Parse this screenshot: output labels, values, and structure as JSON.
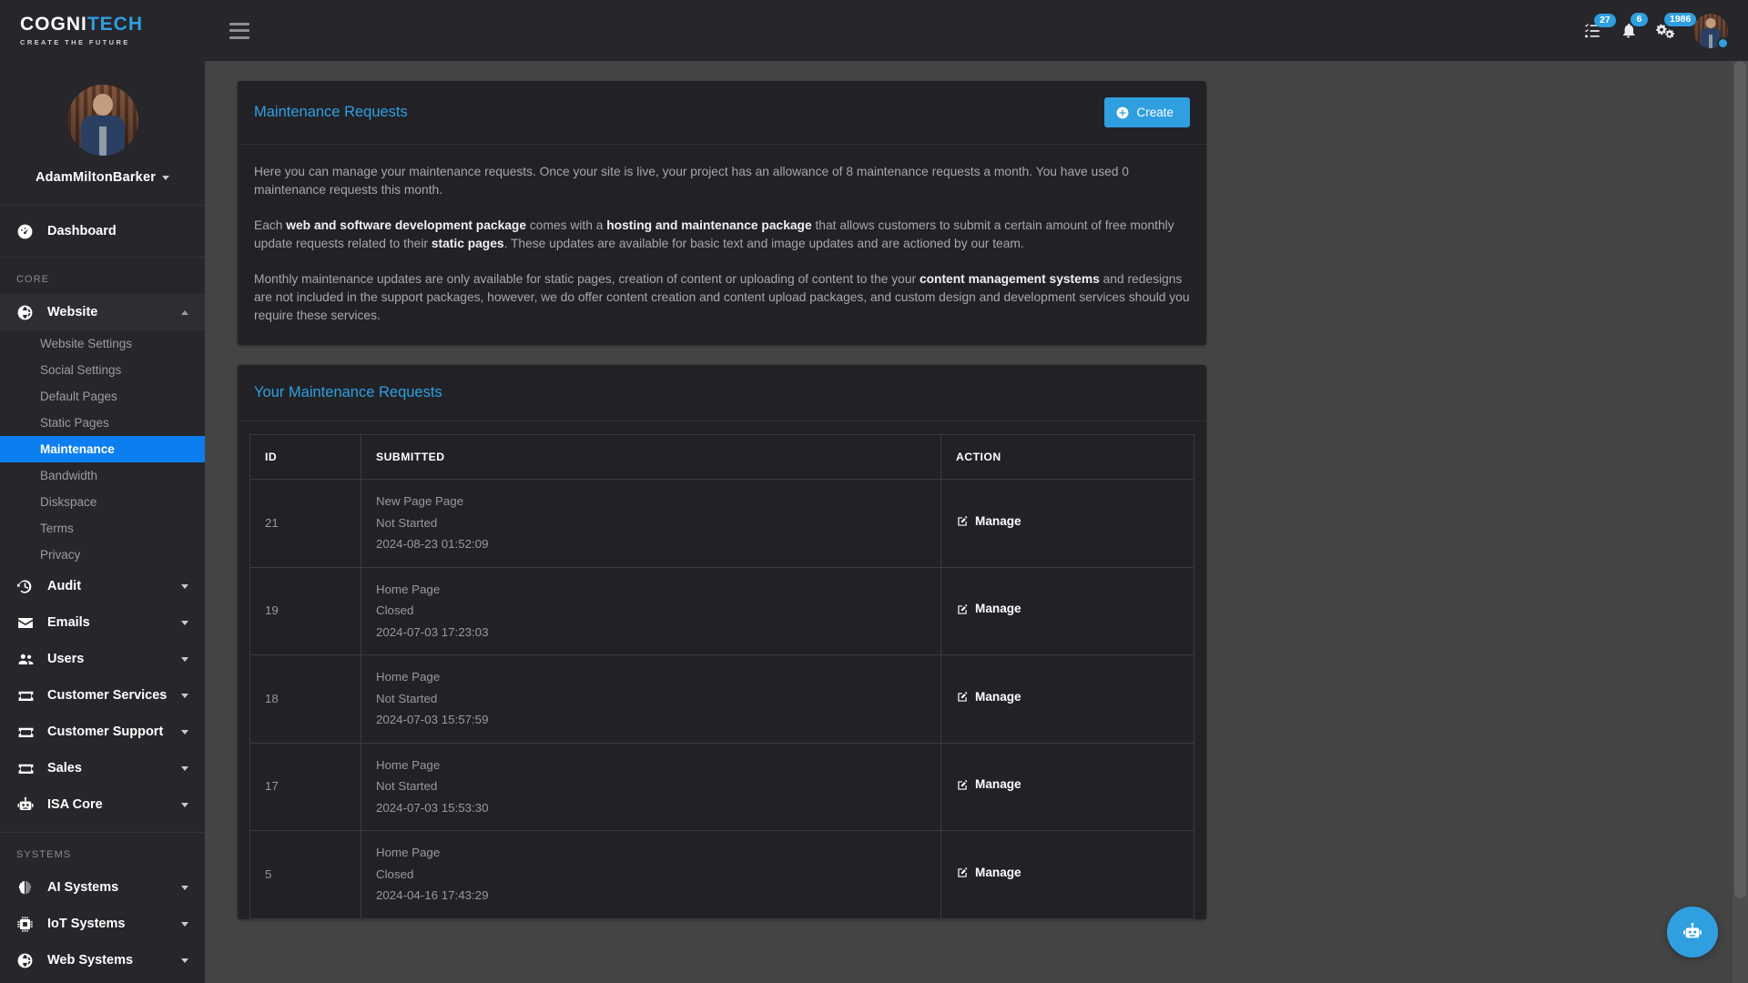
{
  "brand": {
    "name_light": "COGNI",
    "name_accent": "TECH",
    "tagline": "CREATE THE FUTURE",
    "accent_color": "#2f9fe0"
  },
  "topbar": {
    "menu_toggle": "hamburger-menu",
    "tasks": {
      "icon": "tasks-icon",
      "badge": "27"
    },
    "notifications": {
      "icon": "bell-icon",
      "badge": "6"
    },
    "settings": {
      "icon": "gears-icon",
      "badge": "1986"
    },
    "avatar": {
      "icon": "user-avatar",
      "status": "online"
    }
  },
  "sidebar": {
    "profile": {
      "name": "AdamMiltonBarker",
      "caret": "chevron-down-icon"
    },
    "dashboard": {
      "label": "Dashboard",
      "icon": "tachometer-icon"
    },
    "sections": [
      {
        "label": "CORE",
        "items": [
          {
            "label": "Website",
            "icon": "globe-icon",
            "expanded": true,
            "children": [
              {
                "label": "Website Settings",
                "selected": false
              },
              {
                "label": "Social Settings",
                "selected": false
              },
              {
                "label": "Default Pages",
                "selected": false
              },
              {
                "label": "Static Pages",
                "selected": false
              },
              {
                "label": "Maintenance",
                "selected": true
              },
              {
                "label": "Bandwidth",
                "selected": false
              },
              {
                "label": "Diskspace",
                "selected": false
              },
              {
                "label": "Terms",
                "selected": false
              },
              {
                "label": "Privacy",
                "selected": false
              }
            ]
          },
          {
            "label": "Audit",
            "icon": "history-icon",
            "expanded": false
          },
          {
            "label": "Emails",
            "icon": "envelope-icon",
            "expanded": false
          },
          {
            "label": "Users",
            "icon": "users-icon",
            "expanded": false
          },
          {
            "label": "Customer Services",
            "icon": "ticket-icon",
            "expanded": false
          },
          {
            "label": "Customer Support",
            "icon": "ticket-icon",
            "expanded": false
          },
          {
            "label": "Sales",
            "icon": "ticket-icon",
            "expanded": false
          },
          {
            "label": "ISA Core",
            "icon": "robot-icon",
            "expanded": false
          }
        ]
      },
      {
        "label": "SYSTEMS",
        "items": [
          {
            "label": "AI Systems",
            "icon": "brain-icon",
            "expanded": false
          },
          {
            "label": "IoT Systems",
            "icon": "microchip-icon",
            "expanded": false
          },
          {
            "label": "Web Systems",
            "icon": "globe-icon",
            "expanded": false
          }
        ]
      }
    ]
  },
  "info_card": {
    "title": "Maintenance Requests",
    "create_label": "Create",
    "create_icon": "plus-circle-icon",
    "paragraphs": {
      "p1": "Here you can manage your maintenance requests. Once your site is live, your project has an allowance of 8 maintenance requests a month. You have used 0 maintenance requests this month.",
      "p2_a": "Each ",
      "p2_b1": "web and software development package",
      "p2_c": " comes with a ",
      "p2_b2": "hosting and maintenance package",
      "p2_d": " that allows customers to submit a certain amount of free monthly update requests related to their ",
      "p2_b3": "static pages",
      "p2_e": ". These updates are available for basic text and image updates and are actioned by our team.",
      "p3_a": "Monthly maintenance updates are only available for static pages, creation of content or uploading of content to the your ",
      "p3_b1": "content management systems",
      "p3_c": " and redesigns are not included in the support packages, however, we do offer content creation and content upload packages, and custom design and development services should you require these services."
    }
  },
  "requests_card": {
    "title": "Your Maintenance Requests",
    "columns": {
      "id": "ID",
      "submitted": "SUBMITTED",
      "action": "ACTION"
    },
    "action_label": "Manage",
    "action_icon": "pen-to-square-icon",
    "rows": [
      {
        "id": "21",
        "page": "New Page Page",
        "status": "Not Started",
        "timestamp": "2024-08-23 01:52:09"
      },
      {
        "id": "19",
        "page": "Home Page",
        "status": "Closed",
        "timestamp": "2024-07-03 17:23:03"
      },
      {
        "id": "18",
        "page": "Home Page",
        "status": "Not Started",
        "timestamp": "2024-07-03 15:57:59"
      },
      {
        "id": "17",
        "page": "Home Page",
        "status": "Not Started",
        "timestamp": "2024-07-03 15:53:30"
      },
      {
        "id": "5",
        "page": "Home Page",
        "status": "Closed",
        "timestamp": "2024-04-16 17:43:29"
      }
    ]
  },
  "fab": {
    "icon": "robot-icon"
  }
}
